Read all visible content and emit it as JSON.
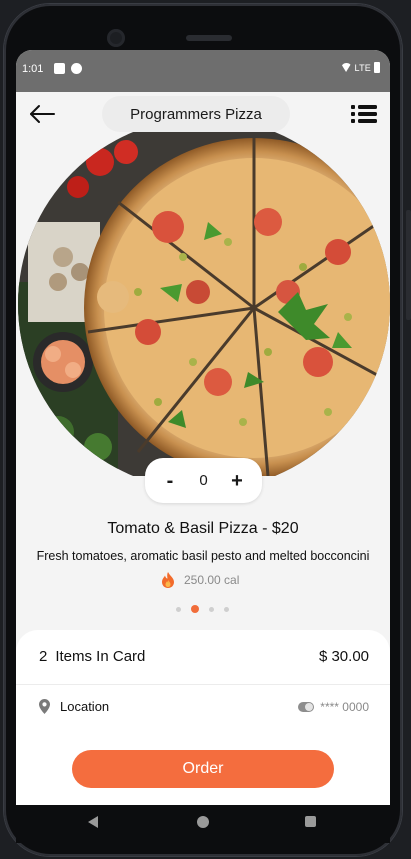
{
  "status_bar": {
    "time": "1:01",
    "network": "LTE",
    "icons": [
      "notification-icon",
      "notification-icon-2",
      "wifi-icon",
      "battery-icon"
    ]
  },
  "header": {
    "title": "Programmers Pizza",
    "back_icon": "arrow-left-icon",
    "menu_icon": "list-menu-icon"
  },
  "product": {
    "image": "tomato-basil-pizza-photo",
    "quantity": {
      "minus_label": "-",
      "value": "0",
      "plus_label": "+"
    },
    "name": "Tomato & Basil Pizza - $20",
    "description": "Fresh tomatoes, aromatic basil pesto and melted bocconcini",
    "calories": "250.00 cal",
    "calories_icon": "fire-icon",
    "carousel": {
      "count": 4,
      "active_index": 1
    }
  },
  "cart": {
    "count": "2",
    "label": "Items In Card",
    "total": "$ 30.00"
  },
  "location": {
    "label": "Location",
    "icon": "location-pin-icon",
    "card_masked": "**** 0000",
    "card_icon": "toggle-icon"
  },
  "order_button": {
    "label": "Order"
  },
  "colors": {
    "accent": "#f46d3e",
    "background": "#f4f4f4",
    "sheet": "#ffffff"
  },
  "nav_bar": {
    "icons": [
      "back-triangle-icon",
      "home-circle-icon",
      "recent-apps-icon"
    ]
  }
}
